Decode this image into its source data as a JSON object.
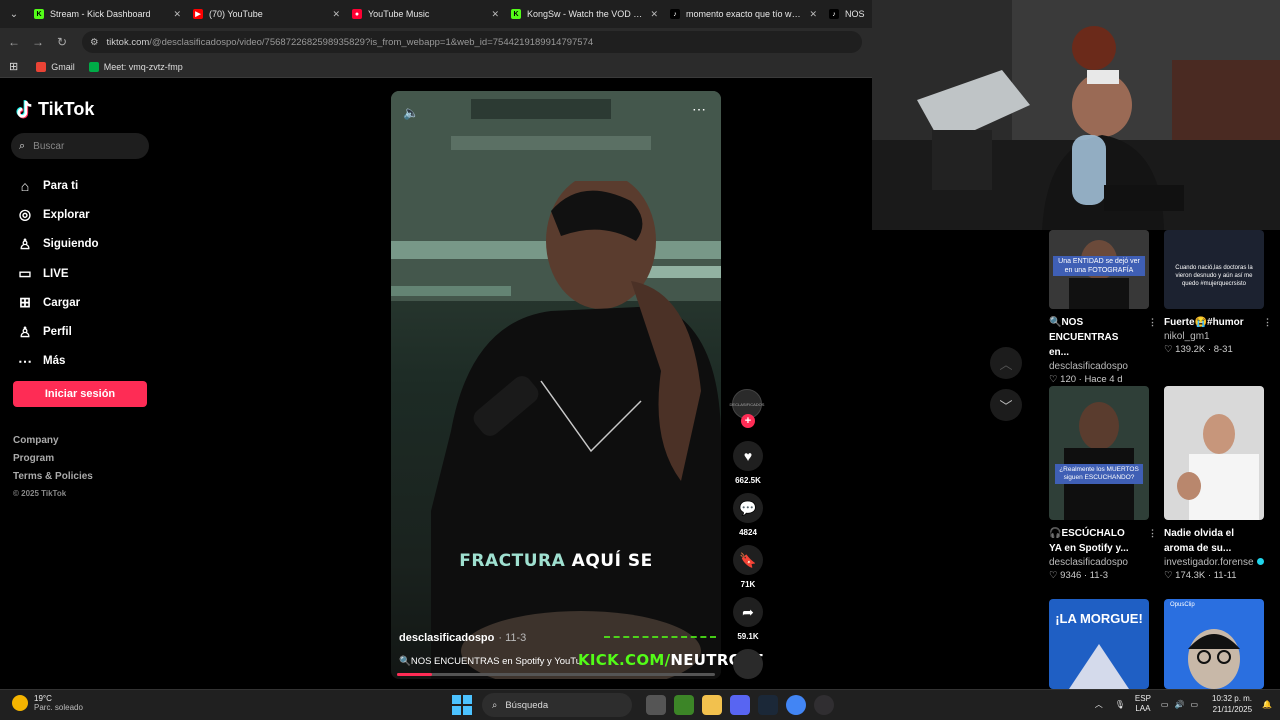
{
  "browser": {
    "tabs": [
      {
        "title": "Stream - Kick Dashboard",
        "favicon_color": "#53fc18",
        "favicon_glyph": "K"
      },
      {
        "title": "(70) YouTube",
        "favicon_color": "#ff0000",
        "favicon_glyph": "▶"
      },
      {
        "title": "YouTube Music",
        "favicon_color": "#ff0033",
        "favicon_glyph": "●"
      },
      {
        "title": "KongSw - Watch the VOD on Ki",
        "favicon_color": "#53fc18",
        "favicon_glyph": "K"
      },
      {
        "title": "momento exacto que tío wafa s",
        "favicon_color": "#000000",
        "favicon_glyph": "♪"
      },
      {
        "title": "NOS",
        "favicon_color": "#000000",
        "favicon_glyph": "♪"
      }
    ],
    "url_site": "tiktok.com",
    "url_path": "/@desclasificadospo/video/7568722682598935829?is_from_webapp=1&web_id=7544219189914797574",
    "bookmarks": [
      {
        "label": "Gmail",
        "color": "#ea4335"
      },
      {
        "label": "Meet: vmq-zvtz-fmp",
        "color": "#00ac47"
      }
    ]
  },
  "tiktok": {
    "logo": "TikTok",
    "search_placeholder": "Buscar",
    "nav": [
      {
        "label": "Para ti",
        "icon": "home-icon"
      },
      {
        "label": "Explorar",
        "icon": "compass-icon"
      },
      {
        "label": "Siguiendo",
        "icon": "user-follow-icon"
      },
      {
        "label": "LIVE",
        "icon": "live-tv-icon"
      },
      {
        "label": "Cargar",
        "icon": "upload-icon"
      },
      {
        "label": "Perfil",
        "icon": "profile-icon"
      },
      {
        "label": "Más",
        "icon": "more-icon"
      }
    ],
    "login_button": "Iniciar sesión",
    "footer": {
      "company": "Company",
      "program": "Program",
      "terms": "Terms & Policies",
      "copyright": "© 2025 TikTok"
    }
  },
  "video": {
    "subtitle_highlight": "FRACTURA",
    "subtitle_rest": " AQUÍ SE",
    "author": "desclasificadospo",
    "date": "· 11-3",
    "caption": "🔍NOS ENCUENTRAS en Spotify y YouTu",
    "progress_fraction": 0.11,
    "overlay_kick": "KICK.COM/",
    "overlay_user": "NEUTROYT",
    "avatar_text": "DECLASIFICADOS",
    "likes": "662.5K",
    "comments": "4824",
    "saves": "71K",
    "shares": "59.1K"
  },
  "related": [
    {
      "thumb_text": "Una ENTIDAD se dejó ver en una FOTOGRAFÍA",
      "title": "🔍NOS ENCUENTRAS en...",
      "author": "desclasificadospo",
      "stats": "♡ 120 · Hace 4 d",
      "verified": false
    },
    {
      "thumb_text": "Cuando nació,las doctoras la vieron desnudo y aún así me quedo #mujerquecrsisto",
      "title": "Fuerte😭#humor",
      "author": "nikol_gm1",
      "stats": "♡ 139.2K · 8-31",
      "verified": false
    },
    {
      "thumb_text": "¿Realmente los MUERTOS siguen ESCUCHANDO?",
      "title": "🎧ESCÚCHALO YA en Spotify y...",
      "author": "desclasificadospo",
      "stats": "♡ 9346 · 11-3",
      "verified": false
    },
    {
      "thumb_text": "",
      "title": "Nadie olvida el aroma de su...",
      "author": "investigador.forense",
      "stats": "♡ 174.3K · 11-11",
      "verified": true
    },
    {
      "thumb_text": "¡LA MORGUE!",
      "title": "",
      "author": "",
      "stats": "",
      "verified": false
    },
    {
      "thumb_text": "OpusClip",
      "title": "",
      "author": "",
      "stats": "",
      "verified": false
    }
  ],
  "taskbar": {
    "temp": "19°C",
    "weather": "Parc. soleado",
    "search": "Búsqueda",
    "lang1": "ESP",
    "lang2": "LAA",
    "time": "10:32 p. m.",
    "date": "21/11/2025"
  }
}
